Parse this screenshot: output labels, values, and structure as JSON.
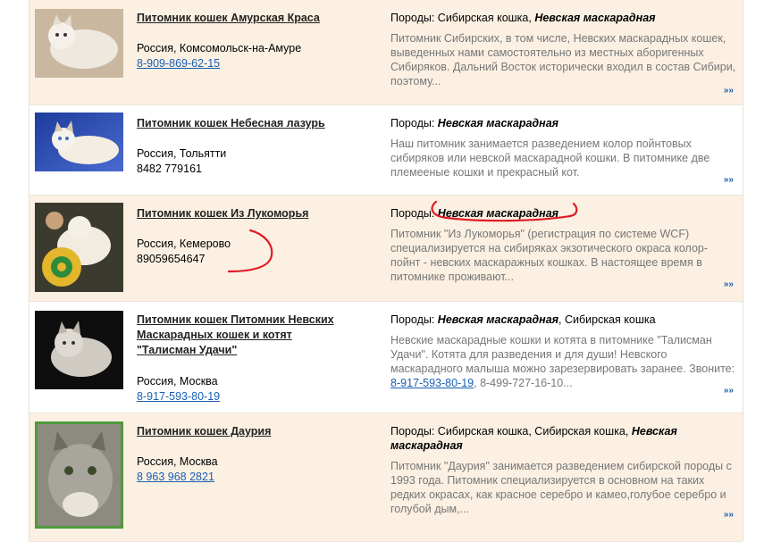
{
  "rows": [
    {
      "title": "Питомник кошек Амурская Краса",
      "location": "Россия, Комсомольск-на-Амуре",
      "phone": "8-909-869-62-15",
      "breeds_prefix": "Породы: Сибирская кошка, ",
      "breeds_bold": "Невская маскарадная",
      "breeds_suffix": "",
      "text": "Питомник Сибирских, в том числе, Невских маскарадных кошек, выведенных нами самостоятельно из местных аборигенных Сибиряков. Дальний Восток исторически входил в состав Сибири, поэтому...",
      "more": "»»"
    },
    {
      "title": "Питомник кошек Небесная лазурь",
      "location": "Россия, Тольятти",
      "phone": "8482 779161",
      "breeds_prefix": "Породы: ",
      "breeds_bold": "Невская маскарадная",
      "breeds_suffix": "",
      "text": "Наш питомник занимается разведением колор пойнтовых сибиряков или невской маскарадной кошки. В питомнике две племееные кошки и прекрасный кот.",
      "more": "»»"
    },
    {
      "title": "Питомник кошек Из Лукоморья",
      "location": "Россия, Кемерово",
      "phone": "89059654647",
      "breeds_prefix": "Породы: ",
      "breeds_bold": "Невская маскарадная",
      "breeds_suffix": "",
      "text": "Питомник \"Из Лукоморья\" (регистрация по системе WCF) специализируется на сибиряках экзотического окраса колор-пойнт - невских маскаражных кошках. В настоящее время в питомнике проживают...",
      "more": "»»"
    },
    {
      "title": "Питомник кошек Питомник Невских Маскарадных кошек и котят \"Талисман Удачи\"",
      "location": "Россия, Москва",
      "phone": "8-917-593-80-19",
      "breeds_prefix": "Породы: ",
      "breeds_bold": "Невская маскарадная",
      "breeds_suffix": ", Сибирская кошка",
      "text_before": "Невские маскарадные кошки и котята в питомнике \"Талисман Удачи\". Котята для разведения и для души! Невского маскарадного малыша можно зарезервировать заранее. Звоните: ",
      "text_link": "8-917-593-80-19",
      "text_after": ", 8-499-727-16-10...",
      "more": "»»"
    },
    {
      "title": "Питомник кошек Даурия",
      "location": "Россия, Москва",
      "phone": "8 963 968 2821",
      "breeds_prefix": "Породы: Сибирская кошка, Сибирская кошка, ",
      "breeds_bold": "Невская маскарадная",
      "breeds_suffix": "",
      "text": "Питомник \"Даурия\" занимается разведением сибирской породы с 1993 года. Питомник специализируется в основном на таких редких окрасах, как красное серебро и камео,голубое серебро и голубой дым,...",
      "more": "»»"
    }
  ],
  "colors": {
    "row_shade": "#fbf0e2",
    "link": "#1a5fb4",
    "desc_text": "#777777",
    "annotation": "#e01b24"
  }
}
